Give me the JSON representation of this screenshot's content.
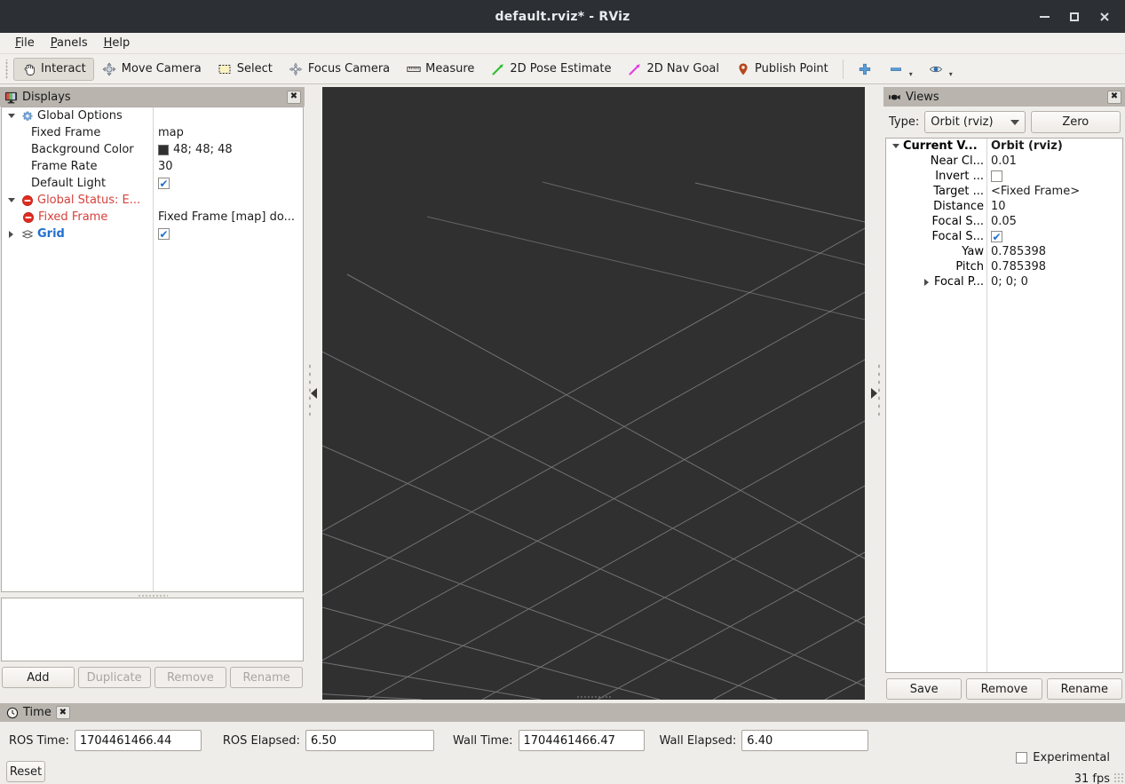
{
  "window": {
    "title": "default.rviz* - RViz",
    "minimize_label": "minimize",
    "maximize_label": "maximize",
    "close_label": "close"
  },
  "menubar": {
    "items": [
      {
        "label": "File",
        "mnemonic": "F"
      },
      {
        "label": "Panels",
        "mnemonic": "P"
      },
      {
        "label": "Help",
        "mnemonic": "H"
      }
    ]
  },
  "toolbar": {
    "items": [
      {
        "label": "Interact",
        "icon": "hand-cursor-icon",
        "checked": true
      },
      {
        "label": "Move Camera",
        "icon": "move-camera-icon",
        "checked": false
      },
      {
        "label": "Select",
        "icon": "select-rectangle-icon",
        "checked": false
      },
      {
        "label": "Focus Camera",
        "icon": "focus-camera-icon",
        "checked": false
      },
      {
        "label": "Measure",
        "icon": "ruler-icon",
        "checked": false
      },
      {
        "label": "2D Pose Estimate",
        "icon": "green-arrow-icon",
        "checked": false
      },
      {
        "label": "2D Nav Goal",
        "icon": "magenta-arrow-icon",
        "checked": false
      },
      {
        "label": "Publish Point",
        "icon": "map-pin-icon",
        "checked": false
      }
    ],
    "extra": [
      {
        "label": "",
        "icon": "plus-icon"
      },
      {
        "label": "",
        "icon": "minus-icon"
      },
      {
        "label": "",
        "icon": "eye-icon"
      }
    ]
  },
  "displays": {
    "header": {
      "title": "Displays",
      "icon": "displays-monitor-icon",
      "close": "✖"
    },
    "rows": [
      {
        "expander": "down",
        "icon": "gear-icon",
        "label": "Global Options",
        "label_style": "bold-dark",
        "value_type": "none",
        "value": "",
        "indent": 0
      },
      {
        "expander": "none",
        "icon": "none",
        "label": "Fixed Frame",
        "label_style": "normal",
        "value_type": "text",
        "value": "map",
        "indent": 1
      },
      {
        "expander": "none",
        "icon": "none",
        "label": "Background Color",
        "label_style": "normal",
        "value_type": "color",
        "value": "48; 48; 48",
        "swatch": "#303030",
        "indent": 1
      },
      {
        "expander": "none",
        "icon": "none",
        "label": "Frame Rate",
        "label_style": "normal",
        "value_type": "text",
        "value": "30",
        "indent": 1
      },
      {
        "expander": "none",
        "icon": "none",
        "label": "Default Light",
        "label_style": "normal",
        "value_type": "checkbox",
        "value": "",
        "checked": true,
        "indent": 1
      },
      {
        "expander": "down",
        "icon": "error-icon",
        "label": "Global Status: E...",
        "label_style": "red",
        "value_type": "none",
        "value": "",
        "indent": 0
      },
      {
        "expander": "none",
        "icon": "error-icon",
        "label": "Fixed Frame",
        "label_style": "red",
        "value_type": "text",
        "value": "Fixed Frame [map] do...",
        "indent": 1
      },
      {
        "expander": "right",
        "icon": "grid-icon",
        "label": "Grid",
        "label_style": "blue-bold",
        "value_type": "checkbox",
        "value": "",
        "checked": true,
        "indent": 0
      }
    ],
    "buttons": [
      {
        "label": "Add",
        "enabled": true
      },
      {
        "label": "Duplicate",
        "enabled": false
      },
      {
        "label": "Remove",
        "enabled": false
      },
      {
        "label": "Rename",
        "enabled": false
      }
    ],
    "description": ""
  },
  "viewport": {
    "background_color": "#303030",
    "grid_line_color": "#9a9a9a",
    "name": "3d-render-view"
  },
  "views": {
    "header": {
      "title": "Views",
      "icon": "views-camera-icon",
      "close": "✖"
    },
    "type_label": "Type:",
    "type_value": "Orbit (rviz)",
    "zero_label": "Zero",
    "rows": [
      {
        "expander": "down",
        "label": "Current V...",
        "label_bold": true,
        "value_type": "text",
        "value": "Orbit (rviz)",
        "value_bold": true,
        "indent": 0
      },
      {
        "expander": "none",
        "label": "Near Cl...",
        "label_bold": false,
        "value_type": "text",
        "value": "0.01",
        "indent": 1
      },
      {
        "expander": "none",
        "label": "Invert ...",
        "label_bold": false,
        "value_type": "checkbox",
        "value": "",
        "checked": false,
        "indent": 1
      },
      {
        "expander": "none",
        "label": "Target ...",
        "label_bold": false,
        "value_type": "text",
        "value": "<Fixed Frame>",
        "indent": 1
      },
      {
        "expander": "none",
        "label": "Distance",
        "label_bold": false,
        "value_type": "text",
        "value": "10",
        "indent": 1
      },
      {
        "expander": "none",
        "label": "Focal S...",
        "label_bold": false,
        "value_type": "text",
        "value": "0.05",
        "indent": 1
      },
      {
        "expander": "none",
        "label": "Focal S...",
        "label_bold": false,
        "value_type": "checkbox",
        "value": "",
        "checked": true,
        "indent": 1
      },
      {
        "expander": "none",
        "label": "Yaw",
        "label_bold": false,
        "value_type": "text",
        "value": "0.785398",
        "indent": 1
      },
      {
        "expander": "none",
        "label": "Pitch",
        "label_bold": false,
        "value_type": "text",
        "value": "0.785398",
        "indent": 1
      },
      {
        "expander": "right",
        "label": "Focal P...",
        "label_bold": false,
        "value_type": "text",
        "value": "0; 0; 0",
        "indent": 1
      }
    ],
    "buttons": [
      {
        "label": "Save",
        "enabled": true
      },
      {
        "label": "Remove",
        "enabled": true
      },
      {
        "label": "Rename",
        "enabled": true
      }
    ]
  },
  "time": {
    "header": {
      "title": "Time",
      "icon": "clock-icon",
      "close": "✖"
    },
    "ros_time_label": "ROS Time:",
    "ros_time_value": "1704461466.44",
    "ros_elapsed_label": "ROS Elapsed:",
    "ros_elapsed_value": "6.50",
    "wall_time_label": "Wall Time:",
    "wall_time_value": "1704461466.47",
    "wall_elapsed_label": "Wall Elapsed:",
    "wall_elapsed_value": "6.40",
    "experimental_label": "Experimental",
    "experimental_checked": false,
    "reset_label": "Reset",
    "fps": "31 fps"
  }
}
